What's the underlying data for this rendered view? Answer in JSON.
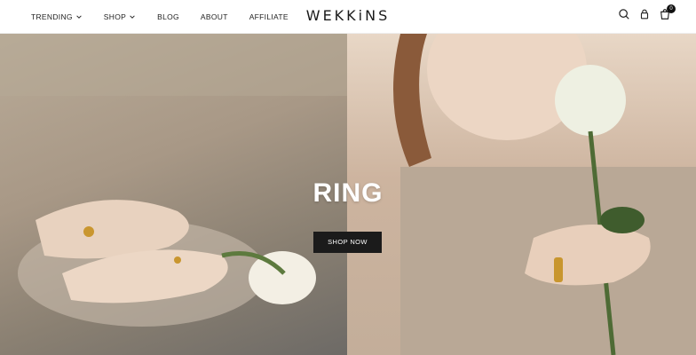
{
  "nav": {
    "items": [
      {
        "label": "TRENDING",
        "dropdown": true
      },
      {
        "label": "SHOP",
        "dropdown": true
      },
      {
        "label": "BLOG",
        "dropdown": false
      },
      {
        "label": "ABOUT",
        "dropdown": false
      },
      {
        "label": "AFFILIATE",
        "dropdown": false
      }
    ]
  },
  "logo": "WEKKiNS",
  "header_icons": {
    "search": "search-icon",
    "account": "user-icon",
    "cart": "cart-icon",
    "cart_count": "0"
  },
  "hero": {
    "title": "RING",
    "cta_label": "SHOP NOW"
  },
  "colors": {
    "cta_bg": "#1b1b1b",
    "text_dark": "#222222"
  }
}
